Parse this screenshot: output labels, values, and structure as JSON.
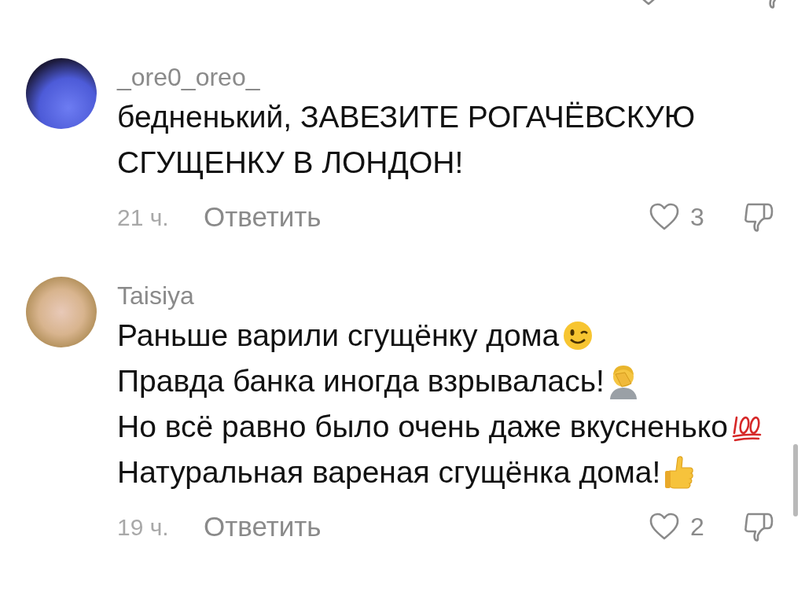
{
  "previous_comment_cut": true,
  "comments": [
    {
      "avatar": {
        "kind": "drawing"
      },
      "username": "_ore0_oreo_",
      "lines": [
        {
          "text": "бедненький, ЗАВЕЗИТЕ РОГАЧЁВСКУЮ"
        },
        {
          "text": "СГУЩЕНКУ В ЛОНДОН!"
        }
      ],
      "time": "21 ч.",
      "reply": "Ответить",
      "likes": "3",
      "liked": false
    },
    {
      "avatar": {
        "kind": "photo"
      },
      "username": "Taisiya",
      "lines": [
        {
          "text": "Раньше варили сгущёнку дома",
          "emoji": {
            "kind": "wink"
          }
        },
        {
          "text": "Правда банка иногда взрывалась!",
          "emoji": {
            "kind": "facepalm"
          }
        },
        {
          "text": "Но всё равно было очень даже вкусненько",
          "emoji": {
            "kind": "hundred"
          }
        },
        {
          "text": "Натуральная вареная сгущёнка дома!",
          "emoji": {
            "kind": "thumbsup"
          }
        }
      ],
      "time": "19 ч.",
      "reply": "Ответить",
      "likes": "2",
      "liked": false
    }
  ]
}
